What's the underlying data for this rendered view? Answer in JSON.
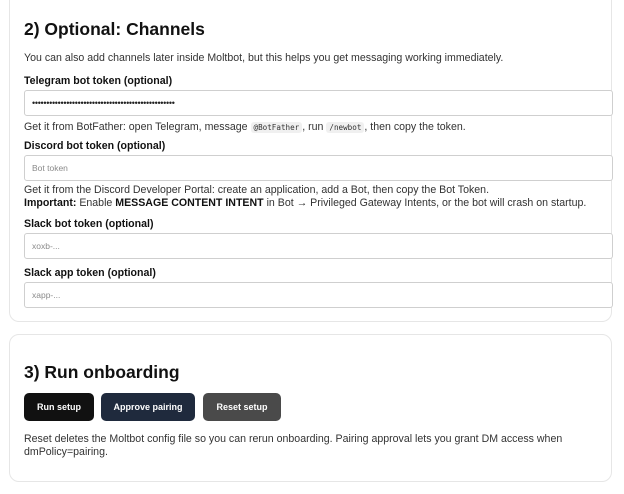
{
  "channels": {
    "title": "2) Optional: Channels",
    "description": "You can also add channels later inside Moltbot, but this helps you get messaging working immediately.",
    "telegram": {
      "label": "Telegram bot token (optional)",
      "value": "••••••••••••••••••••••••••••••••••••••••••••••••••",
      "help_prefix": "Get it from BotFather: open Telegram, message",
      "help_code1": "@BotFather",
      "help_mid": ", run",
      "help_code2": "/newbot",
      "help_suffix": ", then copy the token."
    },
    "discord": {
      "label": "Discord bot token (optional)",
      "placeholder": "Bot token",
      "help_line1": "Get it from the Discord Developer Portal: create an application, add a Bot, then copy the Bot Token.",
      "important_label": "Important:",
      "important_pre": "Enable",
      "important_bold": "MESSAGE CONTENT INTENT",
      "important_post": "in Bot → Privileged Gateway Intents, or the bot will crash on startup."
    },
    "slack_bot": {
      "label": "Slack bot token (optional)",
      "placeholder": "xoxb-..."
    },
    "slack_app": {
      "label": "Slack app token (optional)",
      "placeholder": "xapp-..."
    }
  },
  "onboarding": {
    "title": "3) Run onboarding",
    "run_label": "Run setup",
    "approve_label": "Approve pairing",
    "reset_label": "Reset setup",
    "note": "Reset deletes the Moltbot config file so you can rerun onboarding. Pairing approval lets you grant DM access when dmPolicy=pairing."
  }
}
